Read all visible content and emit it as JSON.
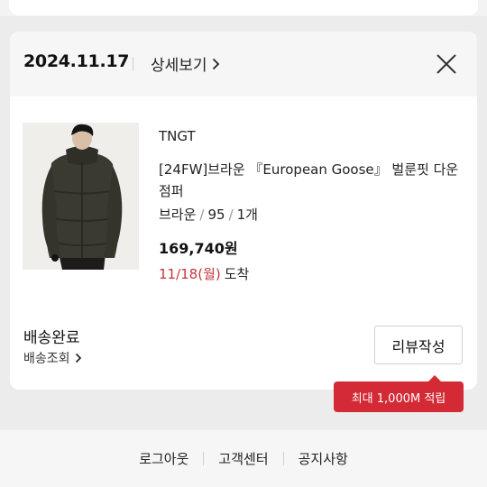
{
  "order": {
    "date": "2024.11.17",
    "detail_label": "상세보기"
  },
  "product": {
    "brand": "TNGT",
    "name": "[24FW]브라운 『European Goose』 벌룬핏 다운 점퍼",
    "color": "브라운",
    "size": "95",
    "quantity": "1개",
    "price": "169,740원",
    "arrival_date": "11/18(월)",
    "arrival_label": "도착"
  },
  "delivery": {
    "status": "배송완료",
    "tracking_label": "배송조회"
  },
  "review": {
    "button_label": "리뷰작성",
    "tooltip": "최대 1,000M 적립"
  },
  "footer": {
    "links": [
      "로그아웃",
      "고객센터",
      "공지사항"
    ]
  },
  "colors": {
    "accent": "#d42a35",
    "arrival": "#c7343a"
  }
}
